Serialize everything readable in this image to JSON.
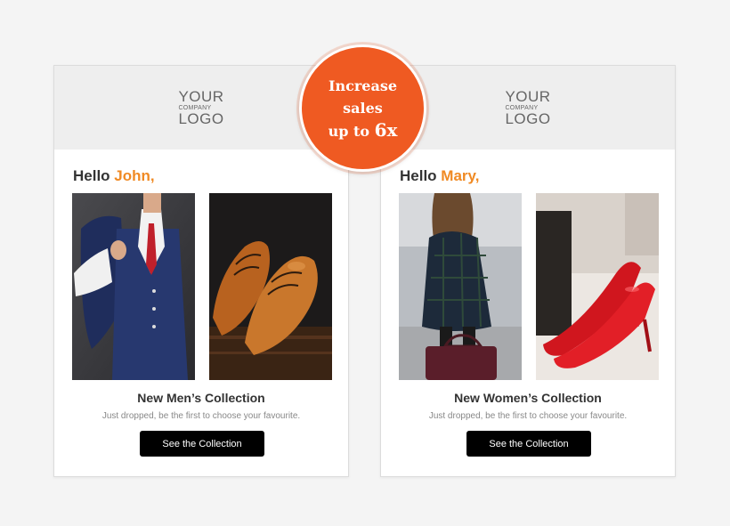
{
  "badge": {
    "line1": "Increase",
    "line2": "sales",
    "line3_prefix": "up to ",
    "line3_value": "6x"
  },
  "cards": [
    {
      "logo": {
        "line1": "YOUR",
        "line2": "COMPANY",
        "line3": "LOGO"
      },
      "greeting_prefix": "Hello ",
      "name": "John,",
      "collection_title": "New Men’s Collection",
      "collection_subtitle": "Just dropped, be the first to choose your favourite.",
      "cta_label": "See the Collection"
    },
    {
      "logo": {
        "line1": "YOUR",
        "line2": "COMPANY",
        "line3": "LOGO"
      },
      "greeting_prefix": "Hello ",
      "name": "Mary,",
      "collection_title": "New Women’s Collection",
      "collection_subtitle": "Just dropped, be the first to choose your favourite.",
      "cta_label": "See the Collection"
    }
  ],
  "colors": {
    "accent": "#f08a24",
    "badge": "#ef5a22",
    "button": "#000000"
  }
}
